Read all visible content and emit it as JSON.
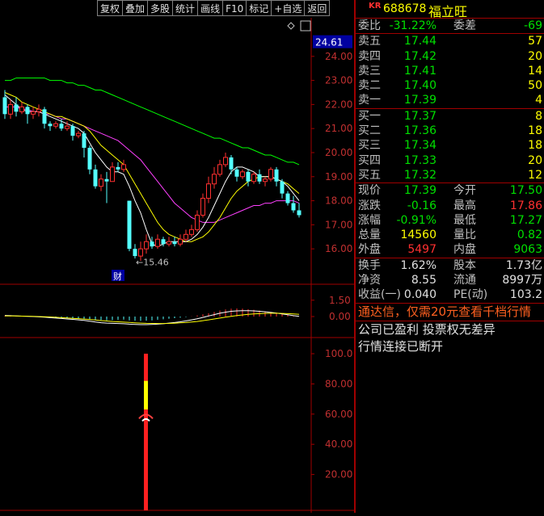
{
  "toolbar": [
    "复权",
    "叠加",
    "多股",
    "统计",
    "画线",
    "F10",
    "标记",
    "+自选",
    "返回"
  ],
  "stock": {
    "market_badge": "KR",
    "code": "688678",
    "name": "福立旺"
  },
  "wb": {
    "label1": "委比",
    "value1": "-31.22%",
    "label2": "委差",
    "value2": "-69"
  },
  "asks": [
    {
      "label": "卖五",
      "price": "17.44",
      "vol": "57"
    },
    {
      "label": "卖四",
      "price": "17.42",
      "vol": "20"
    },
    {
      "label": "卖三",
      "price": "17.41",
      "vol": "14"
    },
    {
      "label": "卖二",
      "price": "17.40",
      "vol": "50"
    },
    {
      "label": "卖一",
      "price": "17.39",
      "vol": "4"
    }
  ],
  "bids": [
    {
      "label": "买一",
      "price": "17.37",
      "vol": "8"
    },
    {
      "label": "买二",
      "price": "17.36",
      "vol": "18"
    },
    {
      "label": "买三",
      "price": "17.34",
      "vol": "18"
    },
    {
      "label": "买四",
      "price": "17.33",
      "vol": "20"
    },
    {
      "label": "买五",
      "price": "17.32",
      "vol": "12"
    }
  ],
  "quote": [
    {
      "l1": "现价",
      "v1": "17.39",
      "c1": "g",
      "l2": "今开",
      "v2": "17.50",
      "c2": "g"
    },
    {
      "l1": "涨跌",
      "v1": "-0.16",
      "c1": "g",
      "l2": "最高",
      "v2": "17.86",
      "c2": "r"
    },
    {
      "l1": "涨幅",
      "v1": "-0.91%",
      "c1": "g",
      "l2": "最低",
      "v2": "17.27",
      "c2": "g"
    },
    {
      "l1": "总量",
      "v1": "14560",
      "c1": "y",
      "l2": "量比",
      "v2": "0.82",
      "c2": "g"
    },
    {
      "l1": "外盘",
      "v1": "5497",
      "c1": "r",
      "l2": "内盘",
      "v2": "9063",
      "c2": "g"
    }
  ],
  "fin": [
    {
      "l1": "换手",
      "v1": "1.62%",
      "l2": "股本",
      "v2": "1.73亿"
    },
    {
      "l1": "净资",
      "v1": "8.55",
      "l2": "流通",
      "v2": "8997万"
    },
    {
      "l1": "收益(一)",
      "v1": "0.040",
      "l2": "PE(动)",
      "v2": "103.2"
    }
  ],
  "notice": "通达信，仅需20元查看千档行情",
  "info1": "公司已盈利 投票权无差异",
  "info2": "行情连接已断开",
  "price_axis": {
    "current": "24.61",
    "ticks": [
      "24.00",
      "23.00",
      "22.00",
      "21.00",
      "20.00",
      "19.00",
      "18.00",
      "17.00",
      "16.00"
    ]
  },
  "macd_axis": {
    "ticks": [
      "1.50",
      "0.00"
    ]
  },
  "ind_axis": {
    "ticks": [
      "100.0",
      "80.00",
      "60.00",
      "40.00",
      "20.00"
    ]
  },
  "annotations": {
    "low_label": "←15.46",
    "fin_badge": "财"
  },
  "colors": {
    "up": "#ff3030",
    "down": "#54ffff",
    "ma5": "#ffffff",
    "ma10": "#ffff00",
    "ma20": "#ff40ff",
    "ma60": "#00ff00",
    "grid": "#a00000"
  },
  "chart_data": {
    "type": "candlestick",
    "ylim": [
      15.2,
      25.0
    ],
    "candles": [
      [
        22.3,
        21.6,
        22.6,
        21.4
      ],
      [
        21.6,
        22.0,
        22.2,
        21.4
      ],
      [
        22.0,
        21.7,
        22.3,
        21.5
      ],
      [
        21.7,
        21.9,
        22.1,
        21.6
      ],
      [
        21.9,
        21.6,
        22.0,
        21.2
      ],
      [
        21.6,
        21.7,
        21.9,
        21.4
      ],
      [
        21.7,
        21.8,
        22.0,
        21.5
      ],
      [
        21.8,
        21.2,
        21.9,
        21.0
      ],
      [
        21.2,
        21.1,
        21.3,
        20.9
      ],
      [
        21.1,
        21.2,
        21.3,
        21.0
      ],
      [
        21.2,
        21.0,
        21.4,
        20.9
      ],
      [
        21.0,
        21.1,
        21.3,
        20.9
      ],
      [
        21.1,
        20.7,
        21.2,
        20.5
      ],
      [
        20.7,
        20.8,
        20.9,
        20.6
      ],
      [
        20.8,
        20.2,
        20.9,
        19.8
      ],
      [
        20.2,
        19.3,
        20.3,
        19.1
      ],
      [
        19.3,
        18.6,
        19.5,
        18.5
      ],
      [
        18.6,
        18.9,
        19.1,
        18.4
      ],
      [
        18.9,
        18.8,
        19.2,
        17.9
      ],
      [
        18.8,
        19.4,
        19.6,
        18.8
      ],
      [
        19.4,
        19.3,
        19.6,
        19.2
      ],
      [
        19.3,
        19.5,
        19.7,
        19.2
      ],
      [
        18.0,
        16.0,
        18.0,
        15.9
      ],
      [
        16.0,
        15.7,
        16.2,
        15.6
      ],
      [
        15.7,
        16.0,
        16.3,
        15.5
      ],
      [
        16.0,
        16.3,
        16.6,
        15.8
      ],
      [
        16.3,
        16.1,
        16.5,
        16.0
      ],
      [
        16.1,
        16.4,
        16.6,
        16.0
      ],
      [
        16.4,
        16.2,
        16.5,
        16.1
      ],
      [
        16.2,
        16.3,
        16.5,
        16.1
      ],
      [
        16.3,
        16.2,
        16.5,
        16.1
      ],
      [
        16.2,
        16.4,
        16.6,
        16.1
      ],
      [
        16.4,
        16.6,
        16.8,
        16.3
      ],
      [
        16.6,
        16.8,
        17.0,
        16.5
      ],
      [
        16.8,
        17.4,
        17.6,
        16.7
      ],
      [
        17.4,
        18.1,
        18.3,
        17.3
      ],
      [
        18.1,
        18.7,
        19.0,
        17.9
      ],
      [
        18.7,
        19.1,
        19.4,
        18.5
      ],
      [
        19.1,
        19.5,
        19.7,
        19.0
      ],
      [
        19.5,
        19.8,
        20.0,
        19.4
      ],
      [
        19.8,
        19.3,
        19.9,
        19.1
      ],
      [
        19.3,
        19.0,
        19.4,
        18.8
      ],
      [
        19.0,
        19.2,
        19.3,
        18.9
      ],
      [
        19.2,
        18.8,
        19.3,
        18.6
      ],
      [
        18.8,
        19.1,
        19.2,
        18.7
      ],
      [
        19.1,
        18.8,
        19.3,
        18.7
      ],
      [
        18.8,
        18.9,
        19.0,
        18.6
      ],
      [
        18.9,
        19.3,
        19.4,
        18.8
      ],
      [
        19.3,
        18.8,
        19.4,
        18.6
      ],
      [
        18.8,
        18.3,
        18.9,
        18.1
      ],
      [
        18.3,
        17.9,
        18.4,
        17.8
      ],
      [
        17.9,
        17.6,
        18.2,
        17.5
      ],
      [
        17.6,
        17.4,
        17.9,
        17.3
      ]
    ],
    "ma5": [
      22.4,
      22.2,
      22.0,
      21.8,
      21.7,
      21.7,
      21.7,
      21.6,
      21.5,
      21.4,
      21.3,
      21.2,
      21.1,
      21.0,
      20.8,
      20.4,
      20.0,
      19.7,
      19.4,
      19.2,
      19.2,
      19.1,
      18.6,
      18.0,
      17.5,
      16.8,
      16.2,
      16.1,
      16.2,
      16.3,
      16.3,
      16.3,
      16.3,
      16.4,
      16.6,
      16.9,
      17.3,
      17.8,
      18.3,
      18.8,
      19.2,
      19.4,
      19.4,
      19.3,
      19.2,
      19.0,
      19.0,
      19.0,
      18.9,
      18.8,
      18.6,
      18.3,
      18.0
    ],
    "ma10": [
      22.5,
      22.4,
      22.3,
      22.1,
      22.0,
      21.9,
      21.8,
      21.7,
      21.6,
      21.5,
      21.5,
      21.4,
      21.3,
      21.2,
      21.1,
      20.9,
      20.6,
      20.3,
      20.1,
      19.9,
      19.7,
      19.5,
      19.1,
      18.7,
      18.3,
      17.9,
      17.5,
      17.1,
      16.8,
      16.6,
      16.5,
      16.4,
      16.3,
      16.3,
      16.4,
      16.5,
      16.7,
      17.0,
      17.3,
      17.7,
      18.1,
      18.4,
      18.6,
      18.8,
      18.9,
      19.0,
      19.0,
      19.0,
      18.9,
      18.8,
      18.7,
      18.5,
      18.3
    ],
    "ma20": [
      21.9,
      21.9,
      21.9,
      21.8,
      21.8,
      21.7,
      21.7,
      21.6,
      21.6,
      21.5,
      21.4,
      21.4,
      21.3,
      21.2,
      21.1,
      21.0,
      20.9,
      20.8,
      20.7,
      20.6,
      20.5,
      20.3,
      20.1,
      19.9,
      19.7,
      19.4,
      19.1,
      18.8,
      18.5,
      18.2,
      17.9,
      17.7,
      17.5,
      17.3,
      17.2,
      17.1,
      17.1,
      17.1,
      17.2,
      17.3,
      17.4,
      17.5,
      17.6,
      17.7,
      17.8,
      17.8,
      17.9,
      17.9,
      18.0,
      18.0,
      18.0,
      18.0,
      17.9
    ],
    "ma60": [
      23.0,
      23.0,
      23.1,
      23.1,
      23.1,
      23.1,
      23.1,
      23.1,
      23.0,
      23.0,
      23.0,
      22.9,
      22.9,
      22.8,
      22.8,
      22.7,
      22.6,
      22.6,
      22.5,
      22.4,
      22.3,
      22.2,
      22.1,
      22.0,
      21.9,
      21.8,
      21.7,
      21.6,
      21.5,
      21.4,
      21.3,
      21.2,
      21.1,
      21.0,
      20.9,
      20.8,
      20.7,
      20.6,
      20.6,
      20.5,
      20.4,
      20.3,
      20.2,
      20.2,
      20.1,
      20.0,
      19.9,
      19.9,
      19.8,
      19.7,
      19.6,
      19.6,
      19.5
    ],
    "macd_hist": [
      0.05,
      0.04,
      0.03,
      0.01,
      0.0,
      -0.02,
      -0.04,
      -0.06,
      -0.08,
      -0.1,
      -0.12,
      -0.14,
      -0.16,
      -0.18,
      -0.22,
      -0.26,
      -0.3,
      -0.32,
      -0.34,
      -0.32,
      -0.3,
      -0.28,
      -0.35,
      -0.38,
      -0.4,
      -0.38,
      -0.35,
      -0.3,
      -0.25,
      -0.2,
      -0.15,
      -0.1,
      -0.05,
      0.02,
      0.1,
      0.2,
      0.3,
      0.42,
      0.55,
      0.65,
      0.72,
      0.74,
      0.72,
      0.68,
      0.62,
      0.55,
      0.48,
      0.4,
      0.32,
      0.24,
      0.16,
      0.08,
      0.02
    ],
    "dif": [
      0.1,
      0.08,
      0.06,
      0.04,
      0.02,
      0.0,
      -0.03,
      -0.06,
      -0.1,
      -0.14,
      -0.18,
      -0.22,
      -0.26,
      -0.3,
      -0.35,
      -0.42,
      -0.5,
      -0.56,
      -0.6,
      -0.62,
      -0.64,
      -0.66,
      -0.7,
      -0.72,
      -0.74,
      -0.74,
      -0.72,
      -0.7,
      -0.66,
      -0.6,
      -0.55,
      -0.48,
      -0.4,
      -0.3,
      -0.2,
      -0.08,
      0.05,
      0.18,
      0.3,
      0.4,
      0.48,
      0.52,
      0.54,
      0.54,
      0.52,
      0.48,
      0.44,
      0.38,
      0.32,
      0.24,
      0.16,
      0.08,
      0.02
    ],
    "dea": [
      0.06,
      0.06,
      0.05,
      0.04,
      0.03,
      0.02,
      0.0,
      -0.02,
      -0.04,
      -0.07,
      -0.1,
      -0.13,
      -0.16,
      -0.19,
      -0.23,
      -0.27,
      -0.32,
      -0.37,
      -0.41,
      -0.45,
      -0.48,
      -0.51,
      -0.54,
      -0.57,
      -0.6,
      -0.62,
      -0.63,
      -0.64,
      -0.64,
      -0.63,
      -0.61,
      -0.58,
      -0.55,
      -0.5,
      -0.45,
      -0.38,
      -0.3,
      -0.22,
      -0.14,
      -0.06,
      0.02,
      0.09,
      0.15,
      0.2,
      0.24,
      0.27,
      0.29,
      0.3,
      0.3,
      0.29,
      0.27,
      0.24,
      0.2
    ],
    "indicator": {
      "index": 40,
      "red_low": 0,
      "yellow_low": 63,
      "yellow_high": 82,
      "red_high": 100,
      "marker": 57
    }
  }
}
